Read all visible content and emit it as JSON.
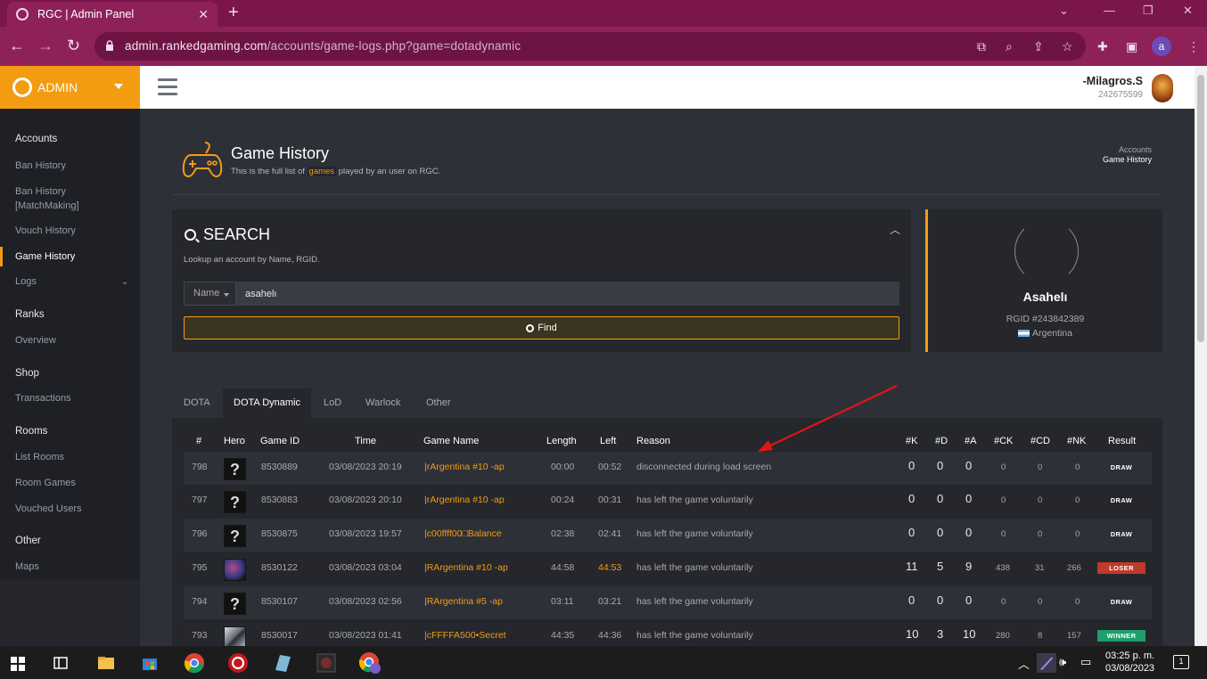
{
  "browser": {
    "tab_title": "RGC | Admin Panel",
    "url_host": "admin.rankedgaming.com",
    "url_path": "/accounts/game-logs.php?game=dotadynamic",
    "profile_initial": "a"
  },
  "brand": {
    "label": "ADMIN"
  },
  "user": {
    "name": "-Milagros.S",
    "id": "242675599"
  },
  "sidebar": {
    "accounts": {
      "title": "Accounts",
      "items": [
        "Ban History",
        "Ban History [MatchMaking]",
        "Vouch History",
        "Game History",
        "Logs"
      ]
    },
    "ranks": {
      "title": "Ranks",
      "items": [
        "Overview"
      ]
    },
    "shop": {
      "title": "Shop",
      "items": [
        "Transactions"
      ]
    },
    "rooms": {
      "title": "Rooms",
      "items": [
        "List Rooms",
        "Room Games",
        "Vouched Users"
      ]
    },
    "other": {
      "title": "Other",
      "items": [
        "Maps"
      ]
    }
  },
  "page": {
    "title": "Game History",
    "subtitle_pre": "This is the full list of",
    "subtitle_hl": "games",
    "subtitle_post": "played by an user on RGC.",
    "crumb_parent": "Accounts",
    "crumb_current": "Game History"
  },
  "search": {
    "title": "SEARCH",
    "hint": "Lookup an account by Name, RGID.",
    "selector": "Name",
    "value": "asahelı",
    "find_label": "Find"
  },
  "profile": {
    "name": "Asahelı",
    "rgid": "RGID #243842389",
    "country": "Argentina"
  },
  "tabs": [
    "DOTA",
    "DOTA Dynamic",
    "LoD",
    "Warlock",
    "Other"
  ],
  "table": {
    "headers": [
      "#",
      "Hero",
      "Game ID",
      "Time",
      "Game Name",
      "Length",
      "Left",
      "Reason",
      "#K",
      "#D",
      "#A",
      "#CK",
      "#CD",
      "#NK",
      "Result"
    ],
    "rows": [
      {
        "n": "798",
        "hero": "?",
        "gid": "8530889",
        "time": "03/08/2023 20:19",
        "name": "|rArgentina #10 -ap",
        "length": "00:00",
        "left": "00:52",
        "reason": "disconnected during load screen",
        "k": "0",
        "d": "0",
        "a": "0",
        "ck": "0",
        "cd": "0",
        "nk": "0",
        "result": "DRAW"
      },
      {
        "n": "797",
        "hero": "?",
        "gid": "8530883",
        "time": "03/08/2023 20:10",
        "name": "|rArgentina #10 -ap",
        "length": "00:24",
        "left": "00:31",
        "reason": "has left the game voluntarily",
        "k": "0",
        "d": "0",
        "a": "0",
        "ck": "0",
        "cd": "0",
        "nk": "0",
        "result": "DRAW"
      },
      {
        "n": "796",
        "hero": "?",
        "gid": "8530875",
        "time": "03/08/2023 19:57",
        "name": "|c00ffff00□Balance",
        "length": "02:38",
        "left": "02:41",
        "reason": "has left the game voluntarily",
        "k": "0",
        "d": "0",
        "a": "0",
        "ck": "0",
        "cd": "0",
        "nk": "0",
        "result": "DRAW"
      },
      {
        "n": "795",
        "hero": "",
        "gid": "8530122",
        "time": "03/08/2023 03:04",
        "name": "|RArgentina #10 -ap",
        "length": "44:58",
        "left": "44:53",
        "reason": "has left the game voluntarily",
        "k": "11",
        "d": "5",
        "a": "9",
        "ck": "438",
        "cd": "31",
        "nk": "266",
        "result": "LOSER"
      },
      {
        "n": "794",
        "hero": "?",
        "gid": "8530107",
        "time": "03/08/2023 02:56",
        "name": "|RArgentina #5 -ap",
        "length": "03:11",
        "left": "03:21",
        "reason": "has left the game voluntarily",
        "k": "0",
        "d": "0",
        "a": "0",
        "ck": "0",
        "cd": "0",
        "nk": "0",
        "result": "DRAW"
      },
      {
        "n": "793",
        "hero": "",
        "gid": "8530017",
        "time": "03/08/2023 01:41",
        "name": "|cFFFFA500•Secret",
        "length": "44:35",
        "left": "44:36",
        "reason": "has left the game voluntarily",
        "k": "10",
        "d": "3",
        "a": "10",
        "ck": "280",
        "cd": "8",
        "nk": "157",
        "result": "WINNER"
      }
    ]
  },
  "taskbar": {
    "time": "03:25 p. m.",
    "date": "03/08/2023",
    "notifications": "1"
  },
  "colors": {
    "accent": "#f39c12",
    "browser": "#8e2258",
    "loser": "#c0392b",
    "winner": "#1e9e6a"
  }
}
